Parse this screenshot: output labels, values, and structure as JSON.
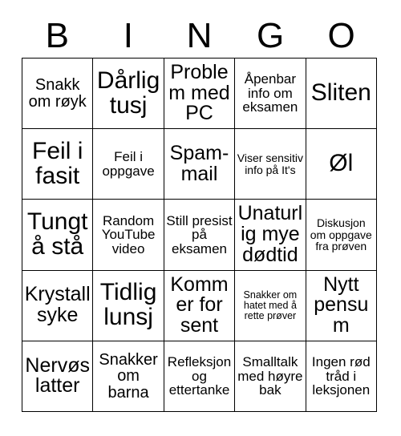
{
  "card": {
    "title": "BINGO",
    "columns": [
      "B",
      "I",
      "N",
      "G",
      "O"
    ],
    "colors": {
      "background": "#ffffff",
      "text": "#000000",
      "border": "#000000"
    },
    "rows": [
      [
        {
          "text": "Snakk om røyk",
          "size": "md"
        },
        {
          "text": "Dårlig tusj",
          "size": "xl"
        },
        {
          "text": "Problem med PC",
          "size": "lg"
        },
        {
          "text": "Åpenbar info om eksamen",
          "size": "sm"
        },
        {
          "text": "Sliten",
          "size": "xl"
        }
      ],
      [
        {
          "text": "Feil i fasit",
          "size": "xl"
        },
        {
          "text": "Feil i oppgave",
          "size": "sm"
        },
        {
          "text": "Spam-mail",
          "size": "lg"
        },
        {
          "text": "Viser sensitiv info på It's",
          "size": "xs"
        },
        {
          "text": "Øl",
          "size": "xl"
        }
      ],
      [
        {
          "text": "Tungt å stå",
          "size": "xl"
        },
        {
          "text": "Random YouTube video",
          "size": "sm"
        },
        {
          "text": "Still presist på eksamen",
          "size": "sm"
        },
        {
          "text": "Unaturlig mye dødtid",
          "size": "lg"
        },
        {
          "text": "Diskusjon om oppgave fra prøven",
          "size": "xs"
        }
      ],
      [
        {
          "text": "Krystall syke",
          "size": "lg"
        },
        {
          "text": "Tidlig lunsj",
          "size": "xl"
        },
        {
          "text": "Kommer for sent",
          "size": "lg"
        },
        {
          "text": "Snakker om hatet med å rette prøver",
          "size": "xxs"
        },
        {
          "text": "Nytt pensum",
          "size": "lg"
        }
      ],
      [
        {
          "text": "Nervøs latter",
          "size": "lg"
        },
        {
          "text": "Snakker om barna",
          "size": "md"
        },
        {
          "text": "Refleksjon og ettertanke",
          "size": "sm"
        },
        {
          "text": "Smalltalk med høyre bak",
          "size": "sm"
        },
        {
          "text": "Ingen rød tråd i leksjonen",
          "size": "sm"
        }
      ]
    ]
  }
}
